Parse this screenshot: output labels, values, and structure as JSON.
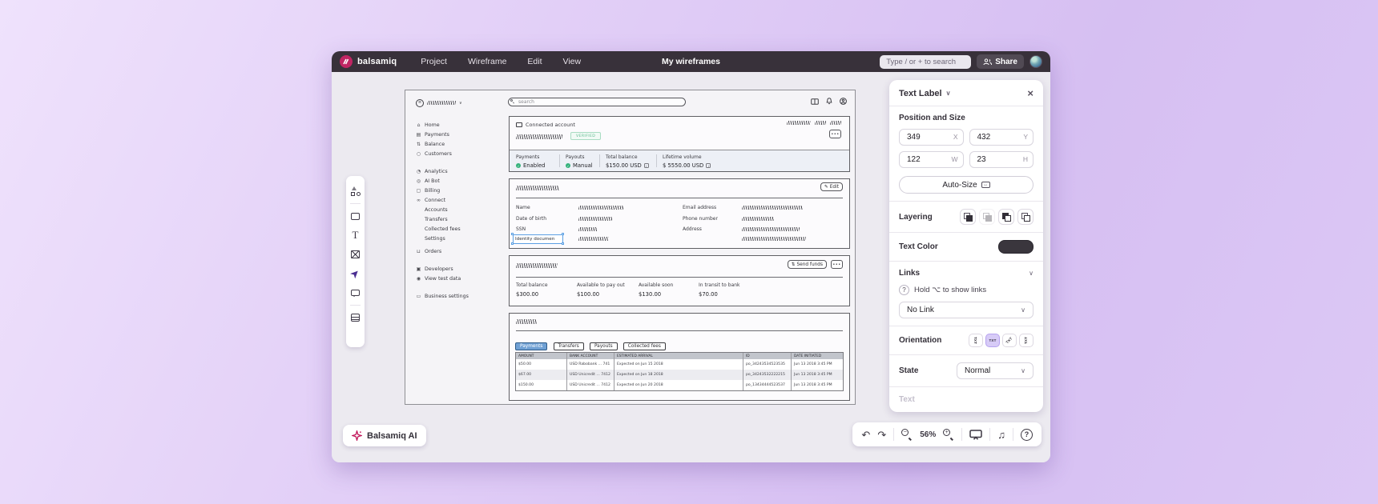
{
  "titlebar": {
    "brand": "balsamiq",
    "menus": [
      "Project",
      "Wireframe",
      "Edit",
      "View"
    ],
    "doc_title": "My wireframes",
    "search_placeholder": "Type / or + to search",
    "share_label": "Share"
  },
  "mockup": {
    "search_placeholder": "search",
    "nav": {
      "main": [
        "Home",
        "Payments",
        "Balance",
        "Customers"
      ],
      "secondary": [
        "Analytics",
        "AI Bot",
        "Billing",
        "Connect"
      ],
      "connect_sub": [
        "Accounts",
        "Transfers",
        "Collected fees",
        "Settings"
      ],
      "orders": "Orders",
      "dev": [
        "Developers",
        "View test data"
      ],
      "business": "Business settings"
    },
    "card_connected": {
      "title": "Connected account",
      "badge": "VERIFIED",
      "stats": [
        {
          "label": "Payments",
          "value": "Enabled"
        },
        {
          "label": "Payouts",
          "value": "Manual"
        },
        {
          "label": "Total balance",
          "value": "$150.00 USD"
        },
        {
          "label": "Lifetime volume",
          "value": "$ 5550.00 USD"
        }
      ]
    },
    "card_profile": {
      "edit_label": "Edit",
      "left_labels": [
        "Name",
        "Date of birth",
        "SSN"
      ],
      "selected_label": "Identity documen",
      "right_labels": [
        "Email address",
        "Phone number",
        "Address"
      ]
    },
    "card_balance": {
      "send_label": "Send funds",
      "stats": [
        {
          "label": "Total balance",
          "value": "$300.00"
        },
        {
          "label": "Available to pay out",
          "value": "$100.00"
        },
        {
          "label": "Available soon",
          "value": "$130.00"
        },
        {
          "label": "In transit to bank",
          "value": "$70.00"
        }
      ]
    },
    "card_table": {
      "tabs": [
        "Payments",
        "Transfers",
        "Payouts",
        "Collected fees"
      ],
      "active_tab": "Payments",
      "headers": [
        "AMOUNT",
        "BANK ACCOUNT",
        "ESTIMATED ARRIVAL",
        "ID",
        "DATE INITIATED"
      ],
      "rows": [
        [
          "$50.00",
          "USD Rabobank ... 741",
          "Expected on Jun 15 2018",
          "po_34243534523535",
          "Jun 13 2018 3:45 PM"
        ],
        [
          "$67.00",
          "USD Unicredit ... 7412",
          "Expected on Jun 18 2018",
          "po_34243532222215",
          "Jun 13 2018 3:45 PM"
        ],
        [
          "$150.00",
          "USD Unicredit ... 7412",
          "Expected on Jun 20 2018",
          "po_13434444523537",
          "Jun 13 2018 3:45 PM"
        ]
      ]
    }
  },
  "inspector": {
    "title": "Text Label",
    "position_heading": "Position and Size",
    "x": "349",
    "x_suffix": "X",
    "y": "432",
    "y_suffix": "Y",
    "w": "122",
    "w_suffix": "W",
    "h": "23",
    "h_suffix": "H",
    "autosize_label": "Auto-Size",
    "layering_label": "Layering",
    "text_color_label": "Text Color",
    "links_label": "Links",
    "links_hint": "Hold ⌥ to show links",
    "link_value": "No Link",
    "orientation_label": "Orientation",
    "orientation_glyph": "TXT",
    "state_label": "State",
    "state_value": "Normal",
    "text_section": "Text"
  },
  "bottombar": {
    "ai_label": "Balsamiq AI",
    "zoom_level": "56%",
    "help_glyph": "?"
  },
  "colors": {
    "accent_purple": "#7c5cd6",
    "brand_magenta": "#c02563",
    "titlebar": "#38313a",
    "wireframe_green": "#34b27b",
    "tab_blue": "#6fa0d4",
    "selection_blue": "#5b9fe3"
  }
}
